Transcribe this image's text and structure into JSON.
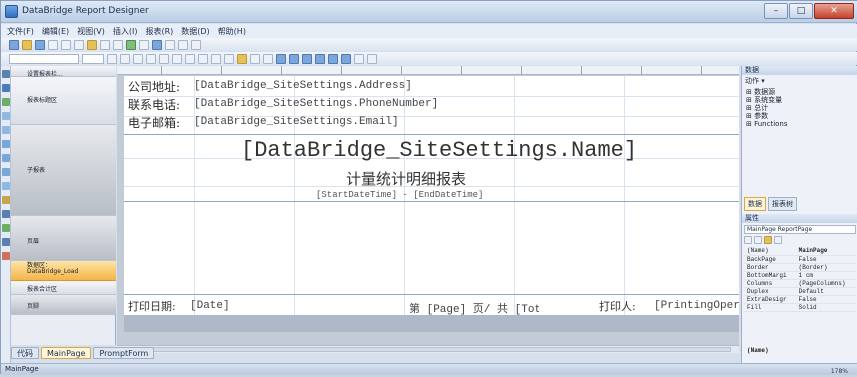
{
  "window": {
    "title": "DataBridge Report Designer"
  },
  "menu": [
    "文件(F)",
    "编辑(E)",
    "视图(V)",
    "插入(I)",
    "报表(R)",
    "数据(D)",
    "帮助(H)"
  ],
  "bands": [
    {
      "label": "设置报表栏...",
      "style": "normal"
    },
    {
      "label": "报表标题区",
      "style": "normal"
    },
    {
      "label": "子报表",
      "style": "dark"
    },
    {
      "label": "页眉",
      "style": "dark"
    },
    {
      "label": "数据区：\nDataBridge_Load",
      "style": "selected"
    },
    {
      "label": "报表合计区",
      "style": "normal"
    },
    {
      "label": "页脚",
      "style": "dark"
    }
  ],
  "report": {
    "address_label": "公司地址:",
    "address_field": "[DataBridge_SiteSettings.Address]",
    "phone_label": "联系电话:",
    "phone_field": "[DataBridge_SiteSettings.PhoneNumber]",
    "email_label": "电子邮箱:",
    "email_field": "[DataBridge_SiteSettings.Email]",
    "site_name": "[DataBridge_SiteSettings.Name]",
    "report_title": "计量统计明细报表",
    "date_range": "[StartDateTime] - [EndDateTime]",
    "print_date_label": "打印日期:",
    "print_date_field": "[Date]",
    "page_info": "第 [Page] 页/ 共 [Tot",
    "printer_label": "打印人:",
    "printer_field": "[PrintingOpera"
  },
  "tabs": {
    "code": "代码",
    "main": "MainPage",
    "prompt": "PromptForm"
  },
  "status": {
    "left": "MainPage",
    "zoom": "178%"
  },
  "data_panel": {
    "title": "数据",
    "actions": "动作 ▾",
    "tree": [
      "⊞ 数据源",
      "⊞ 系统变量",
      "⊞ 总计",
      "⊞ 参数",
      "⊞ Functions"
    ],
    "tab_data": "数据",
    "tab_report_tree": "报表树"
  },
  "props_panel": {
    "title": "属性",
    "object": "MainPage ReportPage",
    "rows": [
      {
        "name": "(Name)",
        "value": "MainPage"
      },
      {
        "name": "BackPage",
        "value": "False"
      },
      {
        "name": "Border",
        "value": "(Border)"
      },
      {
        "name": "BottomMargi",
        "value": "1 cm"
      },
      {
        "name": "Columns",
        "value": "(PageColumns)"
      },
      {
        "name": "Duplex",
        "value": "Default"
      },
      {
        "name": "ExtraDesigr",
        "value": "False"
      },
      {
        "name": "Fill",
        "value": "Solid"
      }
    ],
    "description": "(Name)"
  }
}
